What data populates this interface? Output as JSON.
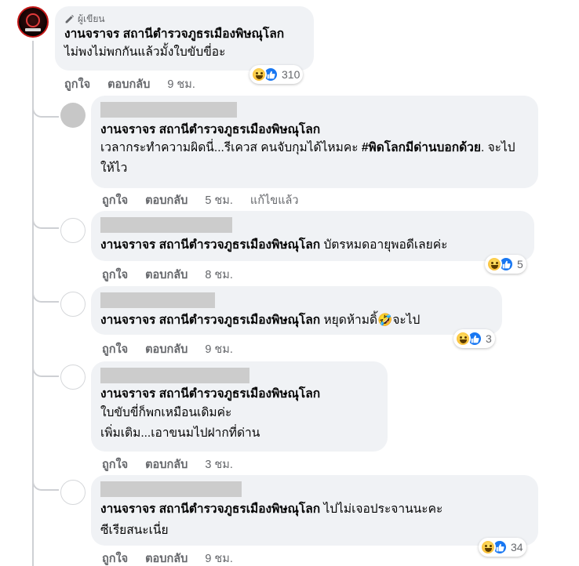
{
  "main_comment": {
    "author_tag": "ผู้เขียน",
    "author": "งานจราจร สถานีตำรวจภูธรเมืองพิษณุโลก",
    "text": "ไม่พงไม่พกกันแล้วมั้งใบขับขี่อะ",
    "like_label": "ถูกใจ",
    "reply_label": "ตอบกลับ",
    "time": "9 ชม.",
    "reaction_count": "310"
  },
  "replies": [
    {
      "author": "งานจราจร สถานีตำรวจภูธรเมืองพิษณุโลก",
      "text_plain": "เวลากระทำความผิดนี่...รีเควส คนจับกุมได้ไหมคะ ",
      "text_bold": "#พิดโลกมีด่านบอกด้วย",
      "text_after": ". จะไปให้ไว",
      "like_label": "ถูกใจ",
      "reply_label": "ตอบกลับ",
      "time": "5 ชม.",
      "edited": "แก้ไขแล้ว"
    },
    {
      "author": "งานจราจร สถานีตำรวจภูธรเมืองพิษณุโลก",
      "text": "บัตรหมดอายุพอดีเลยค่ะ",
      "like_label": "ถูกใจ",
      "reply_label": "ตอบกลับ",
      "time": "8 ชม.",
      "reaction_count": "5"
    },
    {
      "author": "งานจราจร สถานีตำรวจภูธรเมืองพิษณุโลก",
      "text_before": "หยุดห้ามดิ้",
      "emoji": "🤣",
      "text_after": "จะไป",
      "like_label": "ถูกใจ",
      "reply_label": "ตอบกลับ",
      "time": "9 ชม.",
      "reaction_count": "3"
    },
    {
      "author": "งานจราจร สถานีตำรวจภูธรเมืองพิษณุโลก",
      "text_line1": "ใบขับขี่ก็พกเหมือนเดิมค่ะ",
      "text_line2": "เพิ่มเติม...เอาขนมไปฝากที่ด่าน",
      "like_label": "ถูกใจ",
      "reply_label": "ตอบกลับ",
      "time": "3 ชม."
    },
    {
      "author": "งานจราจร สถานีตำรวจภูธรเมืองพิษณุโลก",
      "text_inline": "ไปไม่เจอประจานนะคะ",
      "text_line2": "ซีเรียสนะเนี่ย",
      "like_label": "ถูกใจ",
      "reply_label": "ตอบกลับ",
      "time": "9 ชม.",
      "reaction_count": "34"
    }
  ],
  "colors": {
    "bubble": "#f0f2f5",
    "meta_text": "#65676b",
    "like_blue": "#1877f2",
    "haha_yellow": "#f7b125"
  },
  "icons": [
    "pencil-icon",
    "haha-reaction-icon",
    "like-reaction-icon"
  ]
}
